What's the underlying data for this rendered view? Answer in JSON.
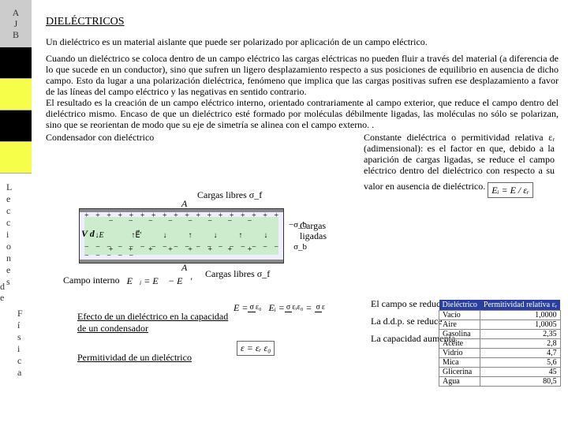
{
  "sidebar": {
    "initials": [
      "A",
      "J",
      "B"
    ],
    "letters": [
      "L",
      "e",
      "c",
      "c",
      "i",
      "o",
      "n",
      "e",
      "s"
    ],
    "de": [
      "d",
      "e"
    ],
    "fisica": [
      "F",
      "í",
      "s",
      "i",
      "c",
      "a"
    ]
  },
  "title": "DIELÉCTRICOS",
  "intro": "Un dieléctrico es un material aislante que puede ser polarizado por aplicación de un campo eléctrico.",
  "body": "Cuando un dieléctrico se coloca dentro de un campo eléctrico las cargas eléctricas no pueden fluir a través del material (a diferencia de lo que sucede en un conductor), sino que sufren un ligero desplazamiento respecto a sus posiciones de equilibrio en ausencia de dicho campo. Esto da lugar a una polarización dieléctrica, fenómeno que implica que las cargas positivas sufren ese desplazamiento a favor de las líneas del campo eléctrico y las negativas en sentido contrario.",
  "body2": "El resultado es la creación de un campo eléctrico interno, orientado contrariamente al campo exterior, que reduce el campo dentro del dieléctrico mismo. Encaso de que un dieléctrico esté formado por moléculas débilmente ligadas, las moléculas no sólo se polarizan, sino que se reorientan de modo que su eje de simetría se alinea con el campo externo. .",
  "right": "Constante dieléctrica o permitividad relativa εᵣ (adimensional): es el factor en que, debido a la aparición de cargas ligadas, se reduce  el campo eléctrico dentro del dieléctrico con respecto a su valor en ausencia de dieléctrico.",
  "labels": {
    "condensador": "Condensador con dieléctrico",
    "cargas_libres": "Cargas libres σ_f",
    "cargas_ligadas": "Cargas\nligadas",
    "campo_interno": "Campo interno",
    "vd": "V d",
    "efecto": "Efecto de un dieléctrico en la capacidad de un condensador",
    "permitividad": "Permitividad de un dieléctrico",
    "campo_reduce": "El campo se reduce",
    "ddp_reduce": "La d.d.p. se reduce",
    "capacidad_aumenta": "La capacidad aumenta"
  },
  "eq": {
    "ei": "E⃗ᵢ = E⃗ − E⃗'",
    "ei2": "Eᵢ = E / εᵣ",
    "eps": "ε = εᵣ ε₀",
    "sigma_b": "−σ_b",
    "sigma_b2": "σ_b",
    "A": "A"
  },
  "perm_table": {
    "headers": [
      "Dieléctrico",
      "Permitividad relativa εᵣ"
    ],
    "rows": [
      [
        "Vacío",
        "1,0000"
      ],
      [
        "Aire",
        "1,0005"
      ],
      [
        "Gasolina",
        "2,35"
      ],
      [
        "Aceite",
        "2,8"
      ],
      [
        "Vidrio",
        "4,7"
      ],
      [
        "Mica",
        "5,6"
      ],
      [
        "Glicerina",
        "45"
      ],
      [
        "Agua",
        "80,5"
      ]
    ]
  }
}
